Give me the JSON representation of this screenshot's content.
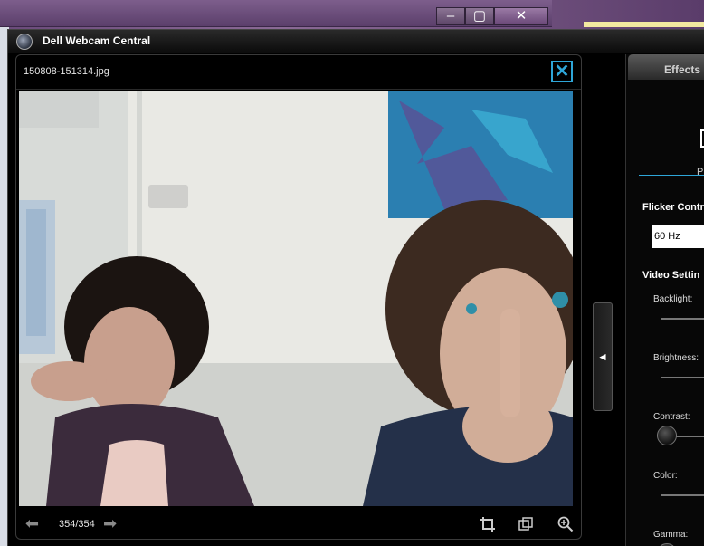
{
  "app": {
    "title": "Dell Webcam Central"
  },
  "viewer": {
    "file_name": "150808-151314.jpg",
    "counter": "354/354",
    "close_icon": "close-icon",
    "prev_icon": "arrow-left-icon",
    "next_icon": "arrow-right-icon",
    "tools": [
      "crop-icon",
      "restore-icon",
      "zoom-in-icon"
    ]
  },
  "collapse_tab": {
    "glyph": "◄"
  },
  "effects": {
    "tab_label": "Effects",
    "sub_tab_label": "Pi",
    "flicker": {
      "heading": "Flicker Contr",
      "value": "60 Hz"
    },
    "video": {
      "heading": "Video Settin",
      "sliders": [
        {
          "label": "Backlight:"
        },
        {
          "label": "Brightness:"
        },
        {
          "label": "Contrast:"
        },
        {
          "label": "Color:"
        },
        {
          "label": "Gamma:"
        }
      ]
    }
  },
  "colors": {
    "accent": "#2ea6d8",
    "window_bg": "#000000"
  }
}
